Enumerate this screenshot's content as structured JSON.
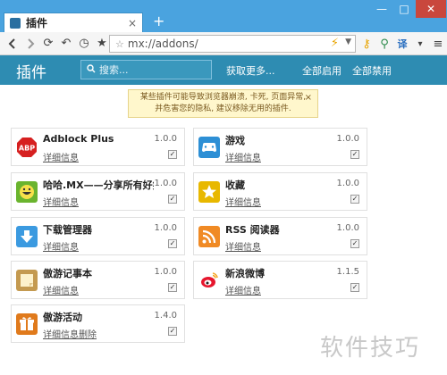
{
  "browser": {
    "tab_title": "插件",
    "tab_close": "×",
    "new_tab": "+",
    "window_controls": {
      "minimize": "—",
      "maximize": "□",
      "close": "✕"
    },
    "url": "mx://addons/",
    "nav_icons": [
      "back-icon",
      "forward-icon",
      "refresh-icon",
      "undo-icon",
      "history-icon",
      "favorite-icon",
      "bookmark-star-icon"
    ]
  },
  "header": {
    "title": "插件",
    "search_placeholder": "搜索...",
    "get_more": "获取更多...",
    "enable_all": "全部启用",
    "disable_all": "全部禁用",
    "colors": {
      "bar": "#2e8cb2",
      "text": "#ffffff"
    }
  },
  "warning": {
    "line1": "某些插件可能导致浏览器崩溃, 卡死, 页面异常,",
    "line2": "并危害您的隐私, 建议移除无用的插件.",
    "close": "×"
  },
  "plugins": [
    {
      "name": "Adblock Plus",
      "version": "1.0.0",
      "detail": "详细信息",
      "enabled": true,
      "icon": "abp-stop-icon",
      "color": "#d62020"
    },
    {
      "name": "游戏",
      "version": "1.0.0",
      "detail": "详细信息",
      "enabled": true,
      "icon": "gamepad-icon",
      "color": "#2d8fd5"
    },
    {
      "name": "哈哈.MX——分享所有好笑的...",
      "version": "1.0.0",
      "detail": "详细信息",
      "enabled": true,
      "icon": "smiley-icon",
      "color": "#6ab42e"
    },
    {
      "name": "收藏",
      "version": "1.0.0",
      "detail": "详细信息",
      "enabled": true,
      "icon": "star-icon",
      "color": "#e8b800"
    },
    {
      "name": "下载管理器",
      "version": "1.0.0",
      "detail": "详细信息",
      "enabled": true,
      "icon": "download-arrow-icon",
      "color": "#3b9ae0"
    },
    {
      "name": "RSS 阅读器",
      "version": "1.0.0",
      "detail": "详细信息",
      "enabled": true,
      "icon": "rss-icon",
      "color": "#f08a24"
    },
    {
      "name": "傲游记事本",
      "version": "1.0.0",
      "detail": "详细信息",
      "enabled": true,
      "icon": "notepad-icon",
      "color": "#c49a50"
    },
    {
      "name": "新浪微博",
      "version": "1.1.5",
      "detail": "详细信息",
      "enabled": true,
      "icon": "weibo-icon",
      "color": "#e6162d"
    },
    {
      "name": "傲游活动",
      "version": "1.4.0",
      "detail": "详细信息",
      "remove": "删除",
      "enabled": true,
      "icon": "gift-icon",
      "color": "#e07a1c"
    }
  ],
  "watermark": "软件技巧"
}
